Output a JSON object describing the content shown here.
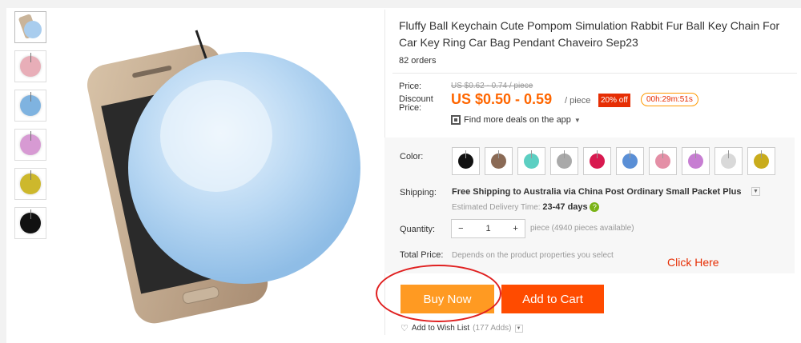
{
  "product": {
    "title": "Fluffy Ball Keychain Cute Pompom Simulation Rabbit Fur Ball Key Chain For Car Key Ring Car Bag Pendant Chaveiro Sep23",
    "orders": "82 orders"
  },
  "thumbnails": [
    {
      "color": "#9cc3e6",
      "icon": "phone-with-blue-ball"
    },
    {
      "color": "#e8aeb8",
      "icon": "pink-ball"
    },
    {
      "color": "#7fb3e0",
      "icon": "blue-ball"
    },
    {
      "color": "#d79ad3",
      "icon": "purple-ball"
    },
    {
      "color": "#cdb82c",
      "icon": "yellow-ball"
    },
    {
      "color": "#111111",
      "icon": "black-ball"
    }
  ],
  "pricing": {
    "price_label": "Price:",
    "original_price": "US $0.62 - 0.74 / piece",
    "discount_label": "Discount Price:",
    "discount_price": "US $0.50 - 0.59",
    "per_unit": "/ piece",
    "discount_badge": "20% off",
    "timer": "00h:29m:51s",
    "deals_link": "Find more deals on the app"
  },
  "color": {
    "label": "Color:",
    "swatches": [
      {
        "color": "#111111",
        "name": "black"
      },
      {
        "color": "#8a6a55",
        "name": "brown"
      },
      {
        "color": "#5ccfc2",
        "name": "mint"
      },
      {
        "color": "#a9a9a9",
        "name": "grey"
      },
      {
        "color": "#d8194f",
        "name": "rose red"
      },
      {
        "color": "#5a8fd6",
        "name": "blue"
      },
      {
        "color": "#e48fa6",
        "name": "pink"
      },
      {
        "color": "#c77ed2",
        "name": "purple"
      },
      {
        "color": "#d9d9d9",
        "name": "white"
      },
      {
        "color": "#c9ac1c",
        "name": "yellow"
      }
    ]
  },
  "shipping": {
    "label": "Shipping:",
    "text": "Free Shipping to Australia via China Post Ordinary Small Packet Plus",
    "delivery_label": "Estimated Delivery Time:",
    "delivery_value": "23-47 days"
  },
  "quantity": {
    "label": "Quantity:",
    "minus": "−",
    "value": "1",
    "plus": "+",
    "availability": "piece (4940 pieces available)"
  },
  "total": {
    "label": "Total Price:",
    "hint": "Depends on the product properties you select"
  },
  "annotation": {
    "click_here": "Click Here"
  },
  "actions": {
    "buy_now": "Buy Now",
    "add_to_cart": "Add to Cart",
    "wish_list": "Add to Wish List",
    "wish_count": "(177 Adds)"
  },
  "colors": {
    "orange": "#ff6600",
    "red": "#e62e04",
    "buy": "#ff9a22",
    "cart": "#ff4b00"
  }
}
